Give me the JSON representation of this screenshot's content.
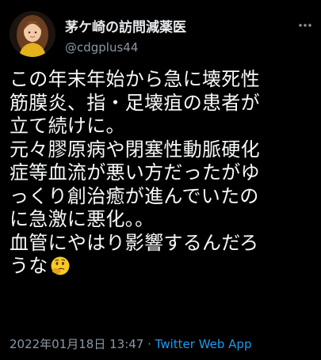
{
  "tweet": {
    "display_name": "茅ケ崎の訪問減薬医",
    "handle": "@cdgplus44",
    "lines": [
      "この年末年始から急に壊死性",
      "筋膜炎、指・足壊疽の患者が",
      "立て続けに。",
      "元々膠原病や閉塞性動脈硬化",
      "症等血流が悪い方だったがゆ",
      "っくり創治癒が進んでいたの",
      "に急激に悪化。。",
      "血管にやはり影響するんだろ",
      "うな"
    ],
    "emoji": "thinking-face-emoji",
    "timestamp": "2022年01月18日 13:47",
    "separator": " · ",
    "source": "Twitter Web App"
  },
  "colors": {
    "background": "#000000",
    "text": "#e7e9ea",
    "secondary": "#8b98a5",
    "link": "#1d9bf0"
  },
  "icons": {
    "more": "more-options-icon",
    "avatar": "avatar-illustration"
  }
}
